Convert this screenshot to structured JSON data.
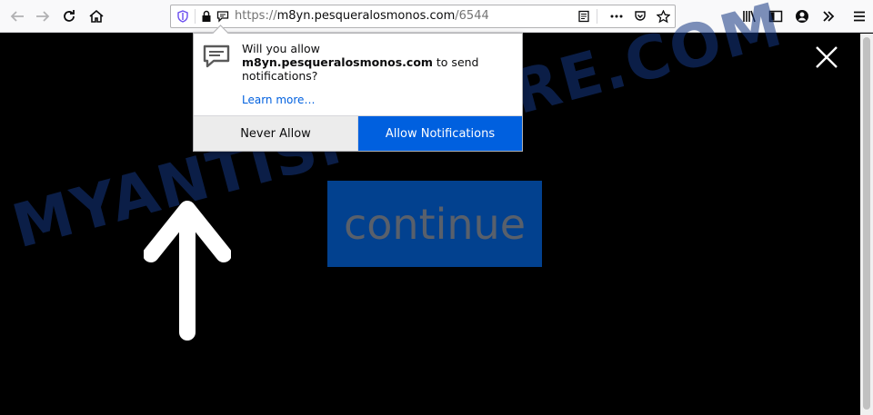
{
  "urlbar": {
    "url_prefix": "https://",
    "url_host": "m8yn.pesqueralosmonos.com",
    "url_path": "/6544"
  },
  "icons": {
    "back": "back-arrow-icon",
    "forward": "forward-arrow-icon",
    "reload": "reload-icon",
    "home": "home-icon",
    "tracking": "shield-icon",
    "lock": "lock-icon",
    "notification_permission": "speech-bubble-icon",
    "reader": "reader-view-icon",
    "page_actions": "more-dots-icon",
    "pocket": "pocket-icon",
    "bookmark": "star-icon",
    "library": "library-icon",
    "sidebar": "sidebar-icon",
    "account": "account-icon",
    "overflow": "chevron-double-right-icon",
    "menu": "hamburger-menu-icon"
  },
  "popup": {
    "line1": "Will you allow",
    "site": "m8yn.pesqueralosmonos.com",
    "line2": " to send notifications?",
    "learn_more": "Learn more…",
    "never_allow": "Never Allow",
    "allow": "Allow Notifications"
  },
  "page": {
    "continue_label": "continue",
    "watermark": "MYANTISPYWARE.COM"
  },
  "colors": {
    "allow_button": "#0060df",
    "continue_button": "#02418f",
    "page_background": "#000000"
  }
}
